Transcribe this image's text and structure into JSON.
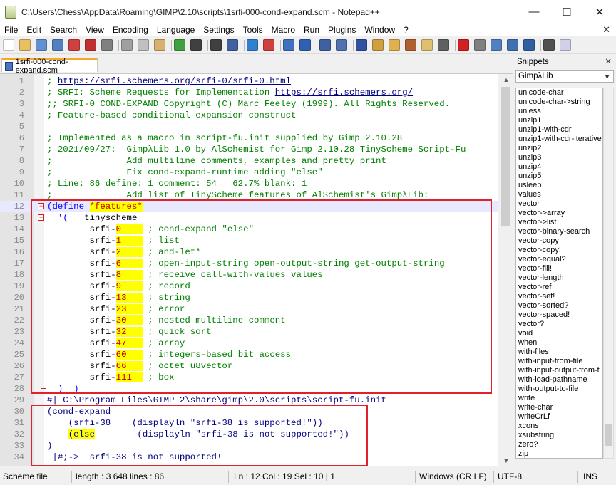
{
  "window": {
    "title": "C:\\Users\\Chess\\AppData\\Roaming\\GIMP\\2.10\\scripts\\1srfi-000-cond-expand.scm - Notepad++",
    "minimize": "—",
    "maximize": "☐",
    "close": "✕"
  },
  "menu": {
    "items": [
      "File",
      "Edit",
      "Search",
      "View",
      "Encoding",
      "Language",
      "Settings",
      "Tools",
      "Macro",
      "Run",
      "Plugins",
      "Window",
      "?"
    ],
    "close_doc": "✕"
  },
  "tab": {
    "label": "1srfi-000-cond-expand.scm"
  },
  "editor": {
    "lines": [
      {
        "n": "1",
        "spans": [
          {
            "t": "; ",
            "c": "c-com"
          },
          {
            "t": "https://srfi.schemers.org/srfi-0/srfi-0.html",
            "c": "c-link"
          }
        ]
      },
      {
        "n": "2",
        "spans": [
          {
            "t": "; SRFI: Scheme Requests for Implementation ",
            "c": "c-com"
          },
          {
            "t": "https://srfi.schemers.org/",
            "c": "c-link"
          }
        ]
      },
      {
        "n": "3",
        "spans": [
          {
            "t": ";; SRFI-0 COND-EXPAND Copyright (C) Marc Feeley (1999). All Rights Reserved.",
            "c": "c-com"
          }
        ]
      },
      {
        "n": "4",
        "spans": [
          {
            "t": "; Feature-based conditional expansion construct",
            "c": "c-com"
          }
        ]
      },
      {
        "n": "5",
        "spans": []
      },
      {
        "n": "6",
        "spans": [
          {
            "t": "; Implemented as a macro in script-fu.init supplied by Gimp 2.10.28",
            "c": "c-com"
          }
        ]
      },
      {
        "n": "7",
        "spans": [
          {
            "t": "; 2021/09/27:  GimpλLib 1.0 by AlSchemist for Gimp 2.10.28 TinyScheme Script-Fu",
            "c": "c-com"
          }
        ]
      },
      {
        "n": "8",
        "spans": [
          {
            "t": ";              Add multiline comments, examples and pretty print",
            "c": "c-com"
          }
        ]
      },
      {
        "n": "9",
        "spans": [
          {
            "t": ";              Fix cond-expand-runtime adding \"else\"",
            "c": "c-com"
          }
        ]
      },
      {
        "n": "10",
        "spans": [
          {
            "t": "; Line: 86 define: 1 comment: 54 = 62.7% blank: 1",
            "c": "c-com"
          }
        ]
      },
      {
        "n": "11",
        "spans": [
          {
            "t": ";              Add list of TinyScheme features of AlSchemist's GimpλLib:",
            "c": "c-com"
          }
        ]
      },
      {
        "n": "12",
        "hl": true,
        "spans": [
          {
            "t": "(",
            "c": "c-kw"
          },
          {
            "t": "define",
            "c": "c-kw"
          },
          {
            "t": " ",
            "c": ""
          },
          {
            "t": "*features*",
            "c": "c-num c-y"
          }
        ]
      },
      {
        "n": "13",
        "spans": [
          {
            "t": "  '(   ",
            "c": "c-kw"
          },
          {
            "t": "tinyscheme",
            "c": ""
          }
        ]
      },
      {
        "n": "14",
        "spans": [
          {
            "t": "        srfi-",
            "c": ""
          },
          {
            "t": "0",
            "c": "c-num c-y"
          },
          {
            "t": "    ",
            "c": "c-y"
          },
          {
            "t": " ; cond-expand \"else\"",
            "c": "c-com"
          }
        ]
      },
      {
        "n": "15",
        "spans": [
          {
            "t": "        srfi-",
            "c": ""
          },
          {
            "t": "1",
            "c": "c-num c-y"
          },
          {
            "t": "    ",
            "c": "c-y"
          },
          {
            "t": " ; list",
            "c": "c-com"
          }
        ]
      },
      {
        "n": "16",
        "spans": [
          {
            "t": "        srfi-",
            "c": ""
          },
          {
            "t": "2",
            "c": "c-num c-y"
          },
          {
            "t": "    ",
            "c": "c-y"
          },
          {
            "t": " ; and-let*",
            "c": "c-com"
          }
        ]
      },
      {
        "n": "17",
        "spans": [
          {
            "t": "        srfi-",
            "c": ""
          },
          {
            "t": "6",
            "c": "c-num c-y"
          },
          {
            "t": "    ",
            "c": "c-y"
          },
          {
            "t": " ; open-input-string open-output-string get-output-string",
            "c": "c-com"
          }
        ]
      },
      {
        "n": "18",
        "spans": [
          {
            "t": "        srfi-",
            "c": ""
          },
          {
            "t": "8",
            "c": "c-num c-y"
          },
          {
            "t": "    ",
            "c": "c-y"
          },
          {
            "t": " ; receive call-with-values values",
            "c": "c-com"
          }
        ]
      },
      {
        "n": "19",
        "spans": [
          {
            "t": "        srfi-",
            "c": ""
          },
          {
            "t": "9",
            "c": "c-num c-y"
          },
          {
            "t": "    ",
            "c": "c-y"
          },
          {
            "t": " ; record",
            "c": "c-com"
          }
        ]
      },
      {
        "n": "20",
        "spans": [
          {
            "t": "        srfi-",
            "c": ""
          },
          {
            "t": "13",
            "c": "c-num c-y"
          },
          {
            "t": "   ",
            "c": "c-y"
          },
          {
            "t": " ; string",
            "c": "c-com"
          }
        ]
      },
      {
        "n": "21",
        "spans": [
          {
            "t": "        srfi-",
            "c": ""
          },
          {
            "t": "23",
            "c": "c-num c-y"
          },
          {
            "t": "   ",
            "c": "c-y"
          },
          {
            "t": " ; error",
            "c": "c-com"
          }
        ]
      },
      {
        "n": "22",
        "spans": [
          {
            "t": "        srfi-",
            "c": ""
          },
          {
            "t": "30",
            "c": "c-num c-y"
          },
          {
            "t": "   ",
            "c": "c-y"
          },
          {
            "t": " ; nested multiline comment",
            "c": "c-com"
          }
        ]
      },
      {
        "n": "23",
        "spans": [
          {
            "t": "        srfi-",
            "c": ""
          },
          {
            "t": "32",
            "c": "c-num c-y"
          },
          {
            "t": "   ",
            "c": "c-y"
          },
          {
            "t": " ; quick sort",
            "c": "c-com"
          }
        ]
      },
      {
        "n": "24",
        "spans": [
          {
            "t": "        srfi-",
            "c": ""
          },
          {
            "t": "47",
            "c": "c-num c-y"
          },
          {
            "t": "   ",
            "c": "c-y"
          },
          {
            "t": " ; array",
            "c": "c-com"
          }
        ]
      },
      {
        "n": "25",
        "spans": [
          {
            "t": "        srfi-",
            "c": ""
          },
          {
            "t": "60",
            "c": "c-num c-y"
          },
          {
            "t": "   ",
            "c": "c-y"
          },
          {
            "t": " ; integers-based bit access",
            "c": "c-com"
          }
        ]
      },
      {
        "n": "26",
        "spans": [
          {
            "t": "        srfi-",
            "c": ""
          },
          {
            "t": "66",
            "c": "c-num c-y"
          },
          {
            "t": "   ",
            "c": "c-y"
          },
          {
            "t": " ; octet u8vector",
            "c": "c-com"
          }
        ]
      },
      {
        "n": "27",
        "spans": [
          {
            "t": "        srfi-",
            "c": ""
          },
          {
            "t": "111",
            "c": "c-num c-y"
          },
          {
            "t": "  ",
            "c": "c-y"
          },
          {
            "t": " ; box",
            "c": "c-com"
          }
        ]
      },
      {
        "n": "28",
        "spans": [
          {
            "t": "  )  )",
            "c": "c-kw"
          }
        ]
      },
      {
        "n": "29",
        "spans": [
          {
            "t": "#| C:\\Program Files\\GIMP 2\\share\\gimp\\2.0\\scripts\\script-fu.init",
            "c": "c-dir"
          }
        ]
      },
      {
        "n": "30",
        "spans": [
          {
            "t": "(cond-expand",
            "c": "c-dir"
          }
        ]
      },
      {
        "n": "31",
        "spans": [
          {
            "t": "    (srfi-38    (displayln \"srfi-38 is supported!\"))",
            "c": "c-dir"
          }
        ]
      },
      {
        "n": "32",
        "spans": [
          {
            "t": "    ",
            "c": ""
          },
          {
            "t": "(else",
            "c": "c-dir c-y"
          },
          {
            "t": "        (displayln \"srfi-38 is not supported!\"))",
            "c": "c-dir"
          }
        ]
      },
      {
        "n": "33",
        "spans": [
          {
            "t": ")",
            "c": "c-dir"
          }
        ]
      },
      {
        "n": "34",
        "spans": [
          {
            "t": " |#;->  srfi-38 is not supported!",
            "c": "c-dir"
          }
        ]
      }
    ]
  },
  "snippets": {
    "title": "Snippets",
    "close": "✕",
    "library": "GimpλLib",
    "items": [
      "unicode-char",
      "unicode-char->string",
      "unless",
      "unzip1",
      "unzip1-with-cdr",
      "unzip1-with-cdr-iterative",
      "unzip2",
      "unzip3",
      "unzip4",
      "unzip5",
      "usleep",
      "values",
      "vector",
      "vector->array",
      "vector->list",
      "vector-binary-search",
      "vector-copy",
      "vector-copy!",
      "vector-equal?",
      "vector-fill!",
      "vector-length",
      "vector-ref",
      "vector-set!",
      "vector-sorted?",
      "vector-spaced!",
      "vector?",
      "void",
      "when",
      "with-files",
      "with-input-from-file",
      "with-input-output-from-t",
      "with-load-pathname",
      "with-output-to-file",
      "write",
      "write-char",
      "writeCrLf",
      "xcons",
      "xsubstring",
      "zero?",
      "zip"
    ]
  },
  "status": {
    "filetype": "Scheme file",
    "length": "length : 3 648    lines : 86",
    "position": "Ln : 12    Col : 19    Sel : 10 | 1",
    "eol": "Windows (CR LF)",
    "encoding": "UTF-8",
    "mode": "INS"
  },
  "colors": {
    "accent_tab": "#f7a628",
    "annotation_box": "#e0202a",
    "highlight": "#ffff00"
  }
}
